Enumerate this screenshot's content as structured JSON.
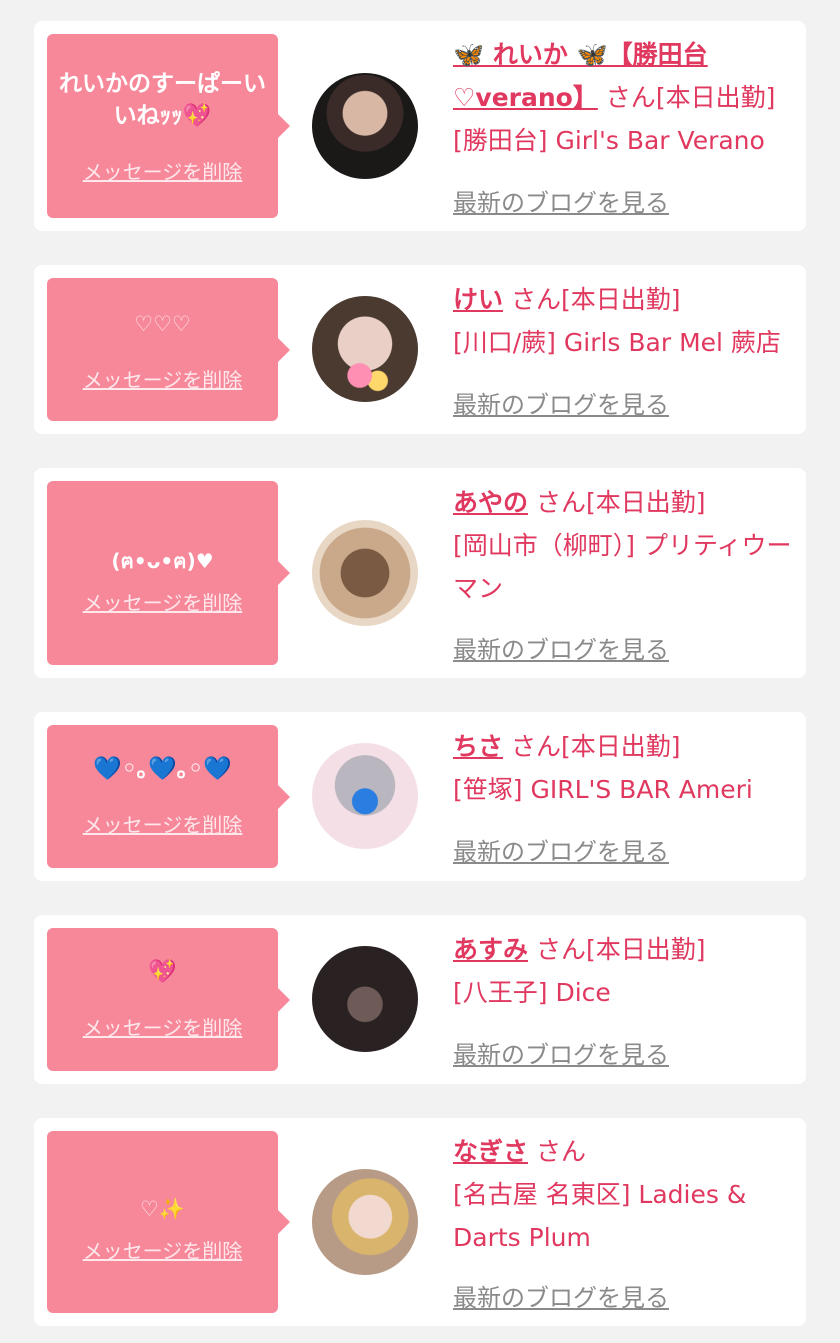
{
  "delete_label": "メッセージを削除",
  "blog_label": "最新のブログを見る",
  "san_label": "さん",
  "accent_color": "#e0385f",
  "bubble_color": "#f7889a",
  "cards": [
    {
      "message": "れいかのすーぱーいいねｯｯ💖",
      "name": "🦋 れいか 🦋【勝田台♡verano】",
      "attendance": "[本日出勤]",
      "shop": "[勝田台] Girl's Bar Verano"
    },
    {
      "message": "♡♡♡",
      "name": "けい",
      "attendance": "[本日出勤]",
      "shop": "[川口/蕨] Girls Bar Mel 蕨店"
    },
    {
      "message": "(ฅ•ᴗ•ฅ)♥",
      "name": "あやの",
      "attendance": "[本日出勤]",
      "shop": "[岡山市（柳町）] プリティウーマン"
    },
    {
      "message": "💙◦｡💙｡◦💙",
      "name": "ちさ",
      "attendance": "[本日出勤]",
      "shop": "[笹塚] GIRL'S BAR Ameri"
    },
    {
      "message": "💖",
      "name": "あすみ",
      "attendance": "[本日出勤]",
      "shop": "[八王子] Dice"
    },
    {
      "message": "♡✨",
      "name": "なぎさ",
      "attendance": "",
      "shop": "[名古屋 名東区] Ladies & Darts Plum"
    }
  ]
}
